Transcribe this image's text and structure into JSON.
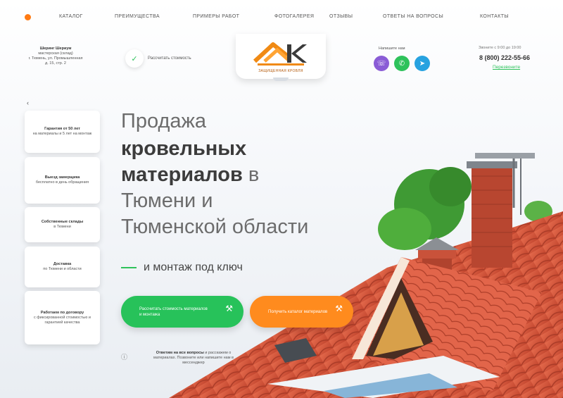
{
  "nav": {
    "items": [
      "КАТАЛОГ",
      "ПРЕИМУЩЕСТВА",
      "ПРИМЕРЫ РАБОТ",
      "ФОТОГАЛЕРЕЯ",
      "ОТЗЫВЫ",
      "ОТВЕТЫ НА ВОПРОСЫ",
      "КОНТАКТЫ"
    ],
    "accent_color": "#ff7a12"
  },
  "header": {
    "address_title": "Шеринг Шериум",
    "address_line1": "мастерская (склад)",
    "address_line2": "г. Тюмень, ул. Промышленная",
    "address_line3": "д. 15, стр. 2",
    "calc_label": "Рассчитать стоимость",
    "logo_sub": "ЗАЩИЩЕННАЯ КРОВЛЯ",
    "messengers_label": "Напишите нам",
    "phone_label": "Звоните с 9:00 до 19:00",
    "phone": "8 (800) 222-55-66",
    "callback": "Перезвоните"
  },
  "side_cards": [
    {
      "bold": "Гарантия от 50 лет",
      "text": "на материалы и 5 лет на монтаж"
    },
    {
      "bold": "Выезд замерщика",
      "text": "бесплатно в день обращения"
    },
    {
      "bold": "Собственные склады",
      "text": "в Тюмени"
    },
    {
      "bold": "Доставка",
      "text": "по Тюмени и области"
    },
    {
      "bold": "Работаем по договору",
      "text": "с фиксированной стоимостью и гарантией качества"
    }
  ],
  "hero": {
    "line1": "Продажа",
    "line2_bold": "кровельных",
    "line3_bold": "материалов",
    "line3_rest": " в",
    "line4": "Тюмени и",
    "line5": "Тюменской области",
    "subtitle": "и монтаж под ключ"
  },
  "buttons": {
    "primary": "Рассчитать стоимость материалов и монтажа",
    "secondary": "Получить каталог материалов"
  },
  "note": {
    "bold": "Ответим на все вопросы",
    "text": "и расскажем о материалах. Позвоните или напишите нам в мессенджер"
  },
  "colors": {
    "green": "#27c25a",
    "orange": "#ff8b1e",
    "roof": "#d9553a",
    "viber": "#8a5cd6",
    "whatsapp": "#2ec25b",
    "telegram": "#27a2e0"
  },
  "icons": {
    "calc": "check-icon",
    "btn_primary": "wrench-icon",
    "btn_secondary": "wrench-icon",
    "messengers": [
      "viber-icon",
      "whatsapp-icon",
      "telegram-icon"
    ]
  }
}
